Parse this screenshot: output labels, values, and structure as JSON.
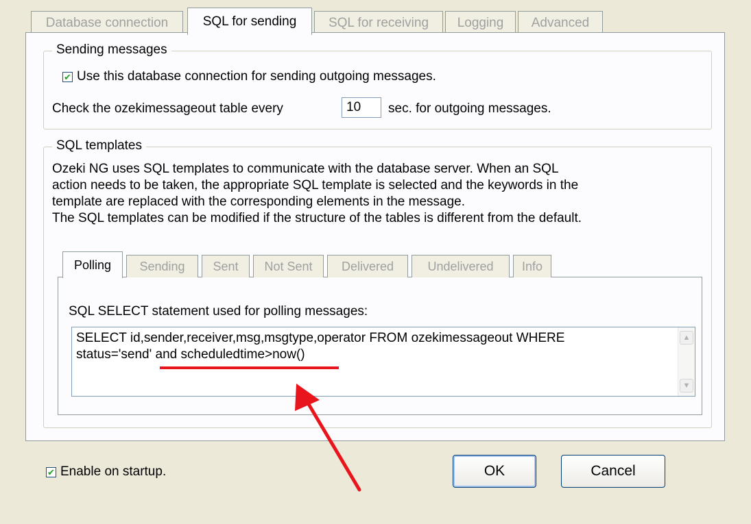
{
  "tabs": [
    "Database connection",
    "SQL for sending",
    "SQL for receiving",
    "Logging",
    "Advanced"
  ],
  "active_tab": "SQL for sending",
  "sending_group": {
    "title": "Sending messages",
    "use_connection_label": "Use this database connection for sending outgoing messages.",
    "use_connection_checked": true,
    "check_table_prefix": "Check the ozekimessageout table every",
    "interval_value": "10",
    "check_table_suffix": "sec. for outgoing messages."
  },
  "templates_group": {
    "title": "SQL templates",
    "description_lines": [
      "Ozeki NG uses SQL templates to communicate with the database server. When an SQL",
      "action needs to be taken, the appropriate SQL template is selected and the keywords in the",
      "template are replaced with the corresponding elements in the message.",
      "The SQL templates can be modified if the structure of the tables is different from the default."
    ],
    "inner_tabs": [
      "Polling",
      "Sending",
      "Sent",
      "Not Sent",
      "Delivered",
      "Undelivered",
      "Info"
    ],
    "active_inner_tab": "Polling",
    "statement_label": "SQL SELECT statement used for polling messages:",
    "statement_lines": [
      "SELECT id,sender,receiver,msg,msgtype,operator FROM ozekimessageout WHERE",
      "status='send' and scheduledtime>now()"
    ]
  },
  "enable_on_startup_label": "Enable on startup.",
  "enable_on_startup_checked": true,
  "ok_label": "OK",
  "cancel_label": "Cancel",
  "annotation_color": "#e8161c"
}
